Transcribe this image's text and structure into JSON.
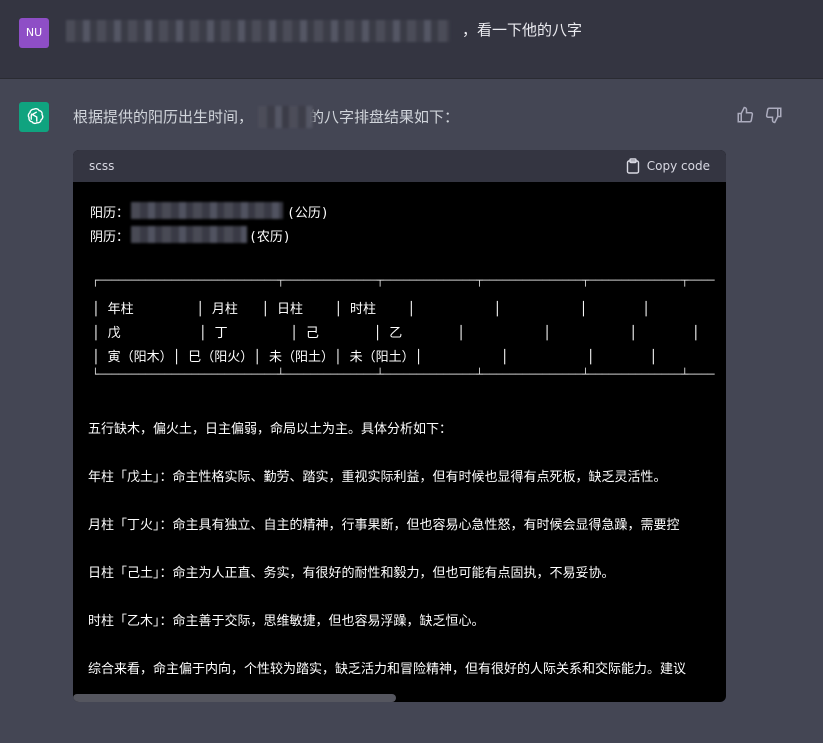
{
  "user": {
    "avatar_initials": "NU",
    "message_suffix": "，看一下他的八字"
  },
  "assistant": {
    "intro_before": "根据提供的阳历出生时间，",
    "intro_after": "的八字排盘结果如下：",
    "feedback": {
      "like_icon": "thumbs-up-icon",
      "dislike_icon": "thumbs-down-icon"
    }
  },
  "code": {
    "language": "scss",
    "copy_label": "Copy code",
    "solar_label": "阳历：",
    "solar_suffix": "(公历)",
    "lunar_label": "阴历：",
    "lunar_suffix": "(农历)",
    "table_top": "┌───────────────────────────┬──────────────┬──────────────┬───────────────┬──────────────┬────",
    "table_rows": [
      "│ 年柱        │ 月柱   │ 日柱    │ 时柱    │          │          │       │",
      "│ 戊          │ 丁        │ 己       │ 乙       │          │          │       │",
      "│ 寅（阳木）│ 巳（阳火）│ 未（阳土）│ 未（阳土）│          │          │       │"
    ],
    "table_bottom": "└───────────────────────────┴──────────────┴──────────────┴───────────────┴──────────────┴────",
    "analysis": [
      "五行缺木，偏火土，日主偏弱，命局以土为主。具体分析如下：",
      "年柱「戊土」：命主性格实际、勤劳、踏实，重视实际利益，但有时候也显得有点死板，缺乏灵活性。",
      "月柱「丁火」：命主具有独立、自主的精神，行事果断，但也容易心急性怒，有时候会显得急躁，需要控",
      "日柱「己土」：命主为人正直、务实，有很好的耐性和毅力，但也可能有点固执，不易妥协。",
      "时柱「乙木」：命主善于交际，思维敏捷，但也容易浮躁，缺乏恒心。",
      "综合来看，命主偏于内向，个性较为踏实，缺乏活力和冒险精神，但有很好的人际关系和交际能力。建议"
    ]
  },
  "colors": {
    "page_bg": "#444654",
    "user_row_bg": "#343541",
    "code_bg": "#000000",
    "gpt_green": "#10a37f",
    "user_avatar": "#8e4ec6"
  }
}
